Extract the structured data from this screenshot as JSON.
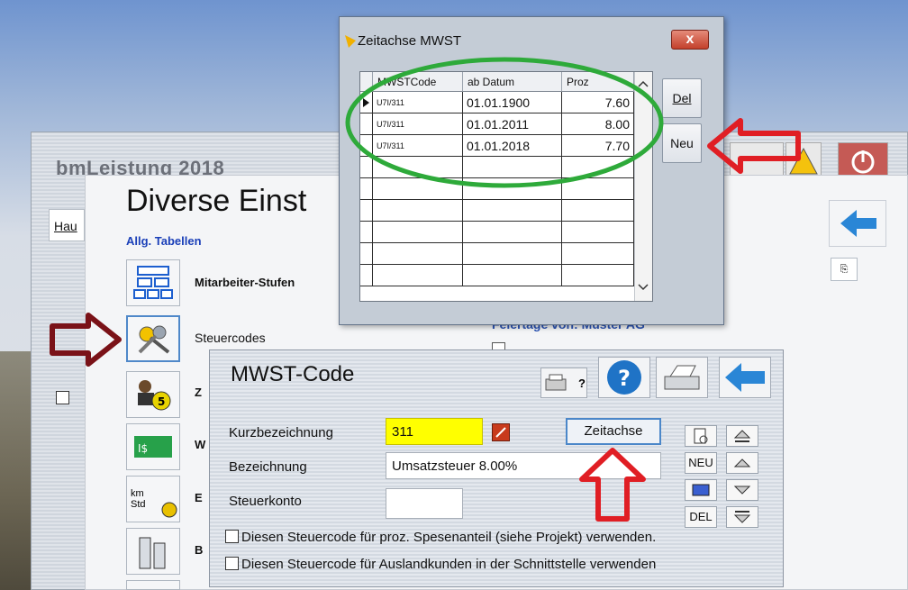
{
  "back_window": {
    "title": "bmLeistung 2018",
    "tab_label": "Hau"
  },
  "diverse_window": {
    "title": "Diverse Einst",
    "subtitle": "Allg. Tabellen",
    "items": [
      {
        "label": "Mitarbeiter-Stufen",
        "icon": "org-chart-icon"
      },
      {
        "label": "Steuercodes",
        "icon": "keys-icon"
      },
      {
        "label": "Z",
        "icon": "person-five-icon"
      },
      {
        "label": "W",
        "icon": "currency-note-icon"
      },
      {
        "label": "E",
        "icon": "km-std-clock-icon"
      },
      {
        "label": "B",
        "icon": "buildings-icon"
      }
    ],
    "km_text": "km",
    "std_text": "Std",
    "money_text": "I$",
    "behind_text": "Feiertage von: Muster AG"
  },
  "zeitachse_dialog": {
    "title": "Zeitachse MWST",
    "close_label": "x",
    "columns": [
      "MWSTCode",
      "ab Datum",
      "Proz"
    ],
    "rows": [
      {
        "code": "U7I/311",
        "date": "01.01.1900",
        "proz": "7.60"
      },
      {
        "code": "U7I/311",
        "date": "01.01.2011",
        "proz": "8.00"
      },
      {
        "code": "U7I/311",
        "date": "01.01.2018",
        "proz": "7.70"
      }
    ],
    "empty_rows": 6,
    "del_label": "Del",
    "neu_label": "Neu"
  },
  "mwst_dialog": {
    "title": "MWST-Code",
    "kurz_label": "Kurzbezeichnung",
    "kurz_value": "311",
    "bez_label": "Bezeichnung",
    "bez_value": "Umsatzsteuer 8.00%",
    "konto_label": "Steuerkonto",
    "konto_value": "",
    "zeitachse_label": "Zeitachse",
    "neu_label": "NEU",
    "del_label": "DEL",
    "print_label": "?",
    "checkbox1": "Diesen Steuercode für proz. Spesenanteil (siehe Projekt) verwenden.",
    "checkbox2": "Diesen Steuercode für Auslandkunden in der Schnittstelle verwenden"
  },
  "colors": {
    "green_circle": "#2eaa3a",
    "red_arrow": "#e01e24",
    "dark_red_arrow": "#7a1218",
    "yellow_field": "#ffff00",
    "blue_arrow": "#2a86d6"
  }
}
